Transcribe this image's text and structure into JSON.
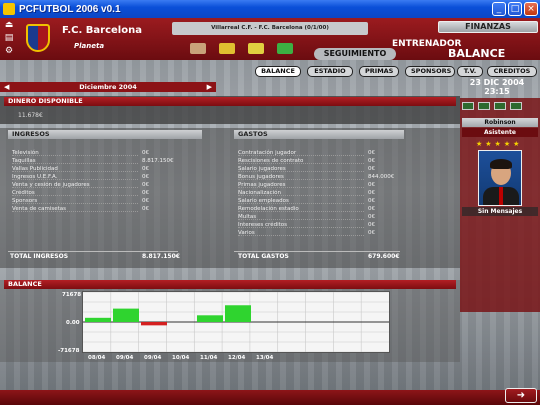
{
  "window": {
    "title": "PCFUTBOL 2006 v0.1",
    "min": "_",
    "max": "□",
    "close": "×"
  },
  "header": {
    "club": "F.C. Barcelona",
    "player": "Planeta",
    "match": "Villarreal C.F. - F.C. Barcelona (0/1/00)",
    "section": "ENTRENADOR",
    "finanzas": "FINANZAS",
    "seguimiento": "SEGUIMIENTO",
    "page_title": "BALANCE"
  },
  "tabs": [
    {
      "label": "BALANCE",
      "active": true
    },
    {
      "label": "ESTADIO",
      "active": false
    },
    {
      "label": "PRIMAS",
      "active": false
    },
    {
      "label": "SPONSORS",
      "active": false
    }
  ],
  "tab_tv": "T.V.",
  "tab_creditos": "CREDITOS",
  "date": {
    "line1": "23 DIC 2004",
    "line2": "23:15"
  },
  "month": {
    "label": "Diciembre 2004",
    "prev": "◀",
    "next": "▶"
  },
  "dinero": {
    "title": "DINERO DISPONIBLE",
    "value": "11.678€"
  },
  "ingresos": {
    "title": "INGRESOS",
    "rows": [
      {
        "label": "Televisión",
        "value": "0€"
      },
      {
        "label": "Taquillas",
        "value": "8.817.150€"
      },
      {
        "label": "Vallas Publicidad",
        "value": "0€"
      },
      {
        "label": "Ingresos U.E.F.A.",
        "value": "0€"
      },
      {
        "label": "Venta y cesión de jugadores",
        "value": "0€"
      },
      {
        "label": "Créditos",
        "value": "0€"
      },
      {
        "label": "Sponsors",
        "value": "0€"
      },
      {
        "label": "Venta de camisetas",
        "value": "0€"
      }
    ],
    "total_label": "TOTAL INGRESOS",
    "total_value": "8.817.150€"
  },
  "gastos": {
    "title": "GASTOS",
    "rows": [
      {
        "label": "Contratación jugador",
        "value": "0€"
      },
      {
        "label": "Rescisiones de contrato",
        "value": "0€"
      },
      {
        "label": "Salario jugadores",
        "value": "0€"
      },
      {
        "label": "Bonus jugadores",
        "value": "844.000€"
      },
      {
        "label": "Primas jugadores",
        "value": "0€"
      },
      {
        "label": "Nacionalización",
        "value": "0€"
      },
      {
        "label": "Salario empleados",
        "value": "0€"
      },
      {
        "label": "Remodelación estadio",
        "value": "0€"
      },
      {
        "label": "Multas",
        "value": "0€"
      },
      {
        "label": "Intereses créditos",
        "value": "0€"
      },
      {
        "label": "Varios",
        "value": "0€"
      }
    ],
    "total_label": "TOTAL GASTOS",
    "total_value": "679.600€"
  },
  "staff": {
    "name": "Robinson",
    "role": "Asistente",
    "stars": "★★★★★",
    "messages": "Sin Mensajes"
  },
  "balance_chart": {
    "title": "BALANCE",
    "y_top": "71678",
    "y_mid": "0.00",
    "y_bot": "-71678",
    "x_labels": [
      "08/04",
      "09/04",
      "09/04",
      "10/04",
      "11/04",
      "12/04",
      "13/04"
    ]
  },
  "chart_data": {
    "type": "bar",
    "categories": [
      "08/04",
      "09/04",
      "09/04",
      "10/04",
      "11/04",
      "12/04",
      "13/04"
    ],
    "values": [
      10000,
      32000,
      -8000,
      0,
      16000,
      40000,
      0
    ],
    "ylim": [
      -71678,
      71678
    ],
    "grid": true,
    "colors": {
      "positive": "#2fd42f",
      "negative": "#d42020"
    }
  }
}
